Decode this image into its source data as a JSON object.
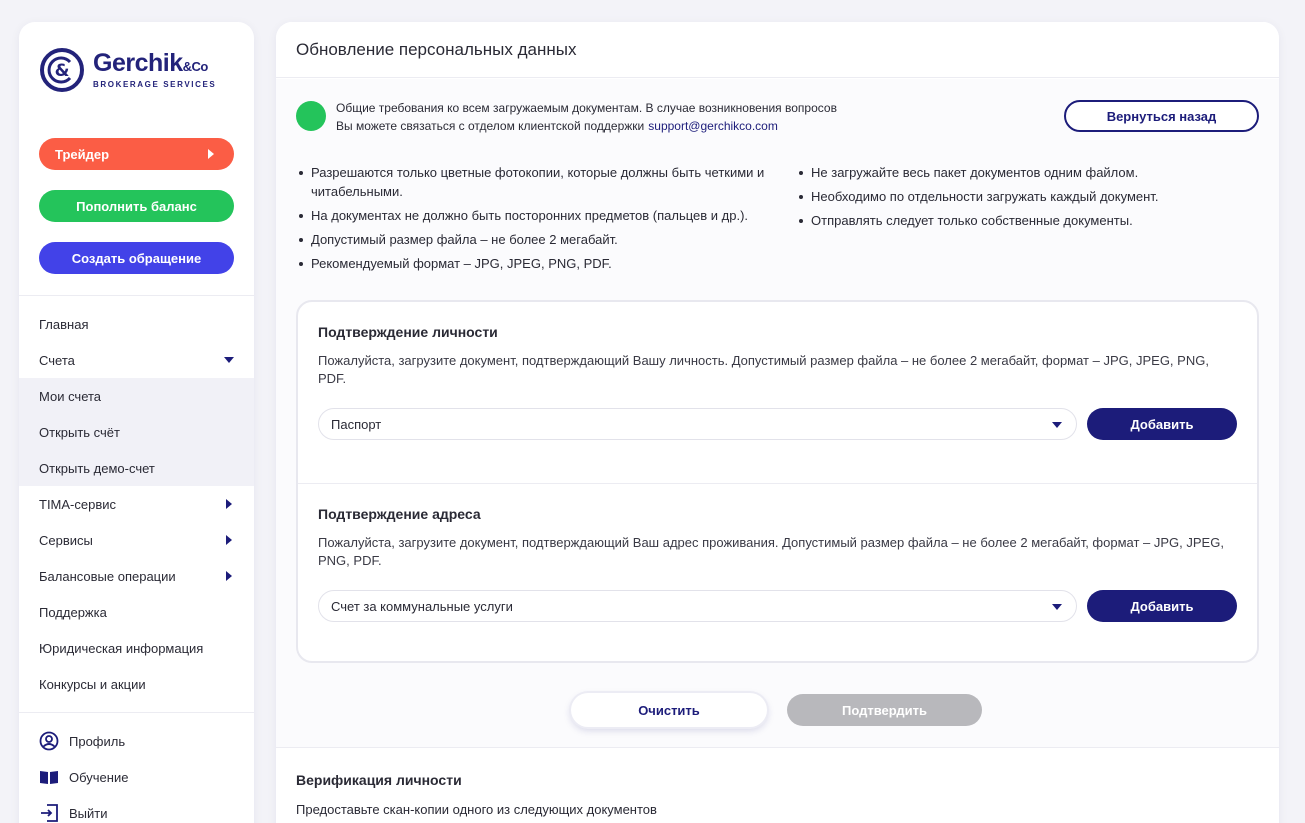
{
  "brand": {
    "name": "Gerchik",
    "name_suffix": "&Co",
    "tagline": "BROKERAGE SERVICES",
    "color": "#23237a"
  },
  "sidebar": {
    "buttons": {
      "trader": "Трейдер",
      "topup": "Пополнить баланс",
      "ticket": "Создать обращение"
    },
    "menu": [
      {
        "label": "Главная"
      },
      {
        "label": "Счета"
      },
      {
        "label": "Мои счета"
      },
      {
        "label": "Открыть счёт"
      },
      {
        "label": "Открыть демо-счет"
      },
      {
        "label": "TIMA-сервис"
      },
      {
        "label": "Сервисы"
      },
      {
        "label": "Балансовые операции"
      },
      {
        "label": "Поддержка"
      },
      {
        "label": "Юридическая информация"
      },
      {
        "label": "Конкурсы и акции"
      }
    ],
    "bottom": [
      {
        "label": "Профиль",
        "icon": "user-circle-icon"
      },
      {
        "label": "Обучение",
        "icon": "book-icon"
      },
      {
        "label": "Выйти",
        "icon": "logout-icon"
      }
    ]
  },
  "main": {
    "title": "Обновление персональных данных",
    "info": {
      "line1": "Общие требования ко всем загружаемым документам. В случае возникновения вопросов",
      "line2": "Вы можете связаться с отделом клиентской поддержки",
      "email": "support@gerchikco.com"
    },
    "back_button": "Вернуться назад",
    "rules_left": [
      "Разрешаются только цветные фотокопии, которые должны быть четкими и читабельными.",
      "На документах не должно быть посторонних предметов (пальцев и др.).",
      "Допустимый размер файла – не более 2 мегабайт.",
      "Рекомендуемый формат – JPG, JPEG, PNG, PDF."
    ],
    "rules_right": [
      "Не загружайте весь пакет документов одним файлом.",
      "Необходимо по отдельности загружать каждый документ.",
      "Отправлять следует только собственные документы."
    ],
    "identity": {
      "title": "Подтверждение личности",
      "description": "Пожалуйста, загрузите документ, подтверждающий Вашу личность. Допустимый размер файла – не более 2 мегабайт, формат – JPG, JPEG, PNG, PDF.",
      "selected": "Паспорт",
      "add_button": "Добавить"
    },
    "address": {
      "title": "Подтверждение адреса",
      "description": "Пожалуйста, загрузите документ, подтверждающий Ваш адрес проживания. Допустимый размер файла – не более 2 мегабайт, формат – JPG, JPEG, PNG, PDF.",
      "selected": "Счет за коммунальные услуги",
      "add_button": "Добавить"
    },
    "clear_button": "Очистить",
    "confirm_button": "Подтвердить",
    "verification": {
      "title": "Верификация личности",
      "description": "Предоставьте скан-копии одного из следующих документов"
    }
  },
  "colors": {
    "trader": "#fb5d45",
    "topup": "#24c45b",
    "ticket": "#4242e8",
    "primary": "#1c1c7a",
    "disabled": "#b8b8bc"
  }
}
